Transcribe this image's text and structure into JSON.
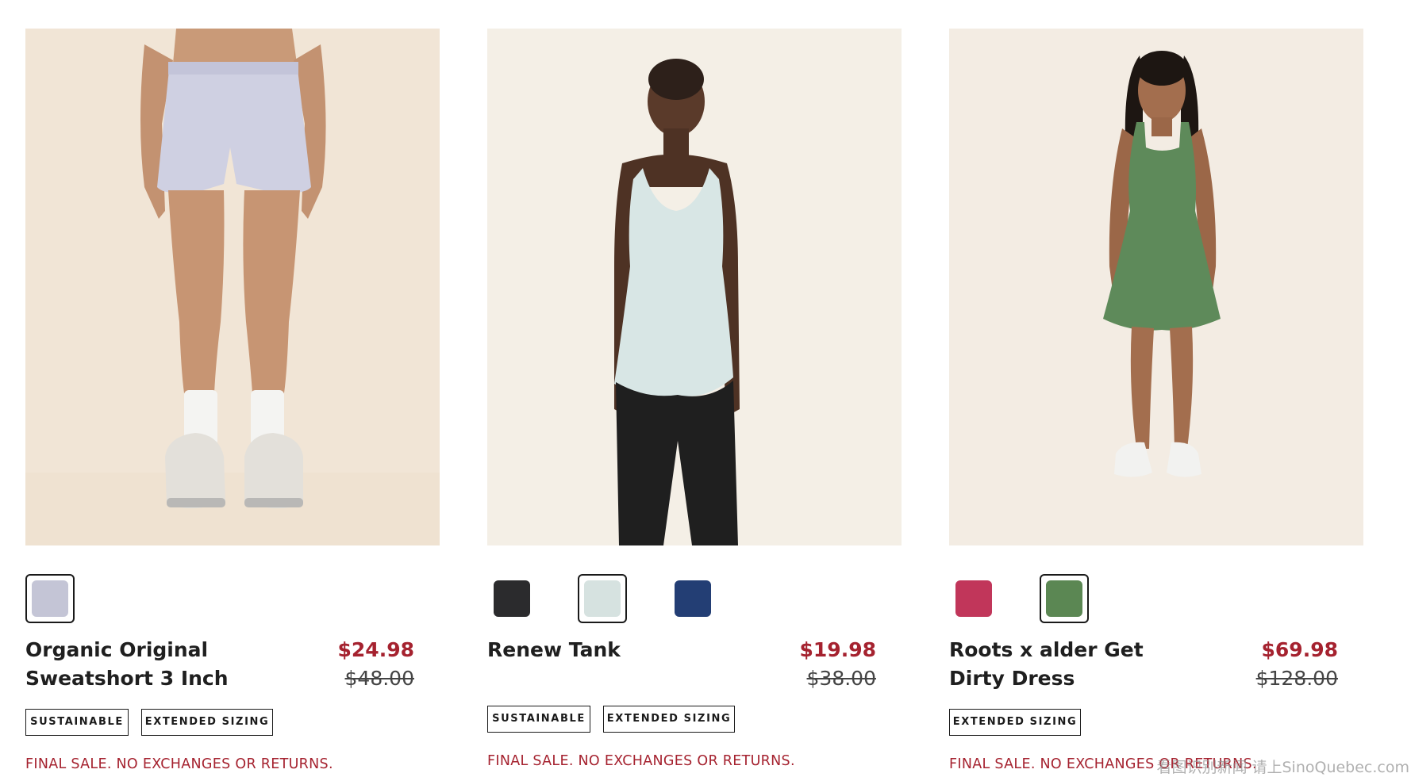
{
  "products": [
    {
      "name": "Organic Original Sweatshort 3 Inch",
      "sale_price": "$24.98",
      "original_price": "$48.00",
      "image_alt": "Model wearing lavender sweatshorts",
      "swatches": [
        {
          "color": "#c4c5d6",
          "selected": true
        }
      ],
      "badges": [
        "SUSTAINABLE",
        "EXTENDED SIZING"
      ],
      "final_sale": "FINAL SALE. NO EXCHANGES OR RETURNS."
    },
    {
      "name": "Renew Tank",
      "sale_price": "$19.98",
      "original_price": "$38.00",
      "image_alt": "Model wearing light mint tank",
      "swatches": [
        {
          "color": "#2b2b2d",
          "selected": false
        },
        {
          "color": "#d6e2e0",
          "selected": true
        },
        {
          "color": "#233e74",
          "selected": false
        }
      ],
      "badges": [
        "SUSTAINABLE",
        "EXTENDED SIZING"
      ],
      "final_sale": "FINAL SALE. NO EXCHANGES OR RETURNS."
    },
    {
      "name": "Roots x alder Get Dirty Dress",
      "sale_price": "$69.98",
      "original_price": "$128.00",
      "image_alt": "Model wearing green dress",
      "swatches": [
        {
          "color": "#c1365a",
          "selected": false
        },
        {
          "color": "#5b8753",
          "selected": true
        }
      ],
      "badges": [
        "EXTENDED SIZING"
      ],
      "final_sale": "FINAL SALE. NO EXCHANGES OR RETURNS."
    }
  ],
  "watermark": "看图识别新闻 请上SinoQuebec.com",
  "colors": {
    "sale_red": "#a5222f",
    "text_dark": "#1f1f1f",
    "photo_bg_1": "#f1e5d6",
    "photo_bg_2": "#f4efe6",
    "photo_bg_3": "#f3ece3"
  }
}
